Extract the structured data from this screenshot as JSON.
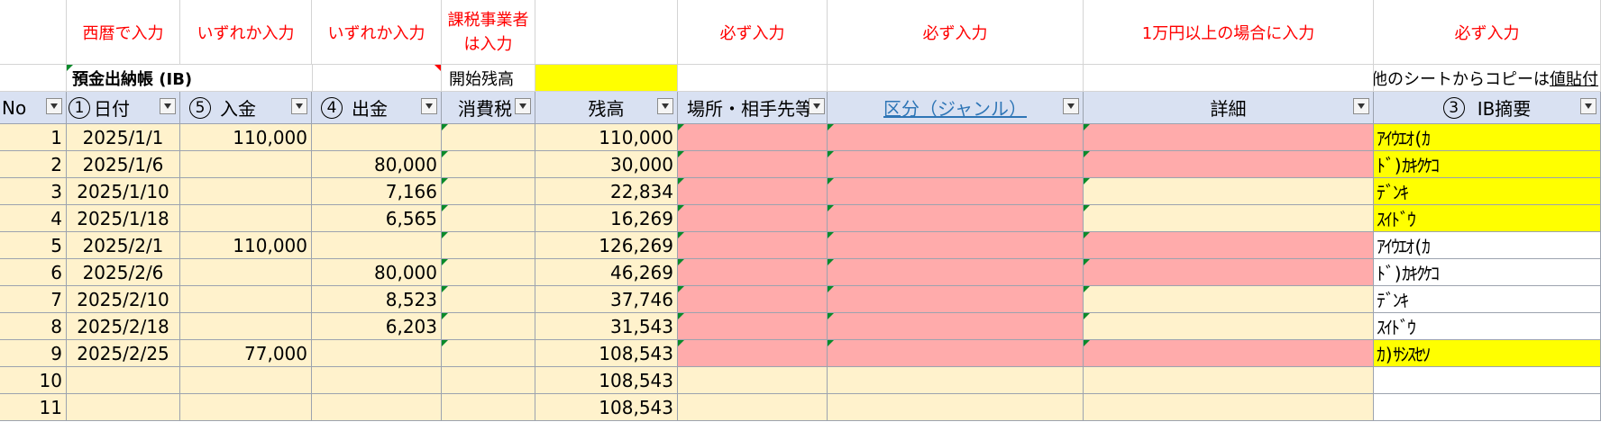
{
  "instructions": {
    "date": "西暦で入力",
    "deposit": "いずれか入力",
    "withdraw": "いずれか入力",
    "tax": "課税事業者は入力",
    "place": "必ず入力",
    "category": "必ず入力",
    "detail": "1万円以上の場合に入力",
    "summary": "必ず入力"
  },
  "title_row": {
    "title": "預金出納帳 (IB)",
    "opening_label": "開始残高",
    "opening_value": "",
    "copy_note_prefix": "他のシートからコピーは",
    "copy_note_link": "値貼付"
  },
  "headers": {
    "no": "No",
    "date_num": "1",
    "date": "日付",
    "deposit_num": "5",
    "deposit": "入金",
    "withdraw_num": "4",
    "withdraw": "出金",
    "tax": "消費税",
    "balance": "残高",
    "place": "場所・相手先等",
    "category": "区分（ジャンル）",
    "detail": "詳細",
    "summary_num": "3",
    "summary": "IB摘要"
  },
  "rows": [
    {
      "no": "1",
      "date": "2025/1/1",
      "deposit": "110,000",
      "withdraw": "",
      "tax": "",
      "balance": "110,000",
      "place": "",
      "category": "",
      "detail": "",
      "summary": "ｱｲｳｴｵ(ｶ",
      "place_color": "pink",
      "category_color": "pink",
      "detail_color": "pink",
      "summary_color": "yellow"
    },
    {
      "no": "2",
      "date": "2025/1/6",
      "deposit": "",
      "withdraw": "80,000",
      "tax": "",
      "balance": "30,000",
      "place": "",
      "category": "",
      "detail": "",
      "summary": "ﾄﾞ)ｶｷｸｹｺ",
      "place_color": "pink",
      "category_color": "pink",
      "detail_color": "pink",
      "summary_color": "yellow"
    },
    {
      "no": "3",
      "date": "2025/1/10",
      "deposit": "",
      "withdraw": "7,166",
      "tax": "",
      "balance": "22,834",
      "place": "",
      "category": "",
      "detail": "",
      "summary": "ﾃﾞﾝｷ",
      "place_color": "pink",
      "category_color": "pink",
      "detail_color": "cream",
      "summary_color": "yellow"
    },
    {
      "no": "4",
      "date": "2025/1/18",
      "deposit": "",
      "withdraw": "6,565",
      "tax": "",
      "balance": "16,269",
      "place": "",
      "category": "",
      "detail": "",
      "summary": "ｽｲﾄﾞｳ",
      "place_color": "pink",
      "category_color": "pink",
      "detail_color": "cream",
      "summary_color": "yellow"
    },
    {
      "no": "5",
      "date": "2025/2/1",
      "deposit": "110,000",
      "withdraw": "",
      "tax": "",
      "balance": "126,269",
      "place": "",
      "category": "",
      "detail": "",
      "summary": "ｱｲｳｴｵ(ｶ",
      "place_color": "pink",
      "category_color": "pink",
      "detail_color": "pink",
      "summary_color": "white"
    },
    {
      "no": "6",
      "date": "2025/2/6",
      "deposit": "",
      "withdraw": "80,000",
      "tax": "",
      "balance": "46,269",
      "place": "",
      "category": "",
      "detail": "",
      "summary": "ﾄﾞ)ｶｷｸｹｺ",
      "place_color": "pink",
      "category_color": "pink",
      "detail_color": "pink",
      "summary_color": "white"
    },
    {
      "no": "7",
      "date": "2025/2/10",
      "deposit": "",
      "withdraw": "8,523",
      "tax": "",
      "balance": "37,746",
      "place": "",
      "category": "",
      "detail": "",
      "summary": "ﾃﾞﾝｷ",
      "place_color": "pink",
      "category_color": "pink",
      "detail_color": "cream",
      "summary_color": "white"
    },
    {
      "no": "8",
      "date": "2025/2/18",
      "deposit": "",
      "withdraw": "6,203",
      "tax": "",
      "balance": "31,543",
      "place": "",
      "category": "",
      "detail": "",
      "summary": "ｽｲﾄﾞｳ",
      "place_color": "pink",
      "category_color": "pink",
      "detail_color": "cream",
      "summary_color": "white"
    },
    {
      "no": "9",
      "date": "2025/2/25",
      "deposit": "77,000",
      "withdraw": "",
      "tax": "",
      "balance": "108,543",
      "place": "",
      "category": "",
      "detail": "",
      "summary": "ｶ)ｻｼｽｾｿ",
      "place_color": "pink",
      "category_color": "pink",
      "detail_color": "pink",
      "summary_color": "yellow"
    },
    {
      "no": "10",
      "date": "",
      "deposit": "",
      "withdraw": "",
      "tax": "",
      "balance": "108,543",
      "place": "",
      "category": "",
      "detail": "",
      "summary": "",
      "place_color": "cream",
      "category_color": "cream",
      "detail_color": "cream",
      "summary_color": "white"
    },
    {
      "no": "11",
      "date": "",
      "deposit": "",
      "withdraw": "",
      "tax": "",
      "balance": "108,543",
      "place": "",
      "category": "",
      "detail": "",
      "summary": "",
      "place_color": "cream",
      "category_color": "cream",
      "detail_color": "cream",
      "summary_color": "white"
    }
  ],
  "colors": {
    "instruction_text": "#ff0000",
    "header_bg": "#d9e1f2",
    "cream": "#fff2cc",
    "pink": "#ffabab",
    "yellow": "#ffff00",
    "link": "#2e75b6"
  },
  "icons": {
    "filter": "filter-dropdown-icon",
    "comment": "comment-indicator-icon",
    "error": "error-indicator-icon"
  }
}
